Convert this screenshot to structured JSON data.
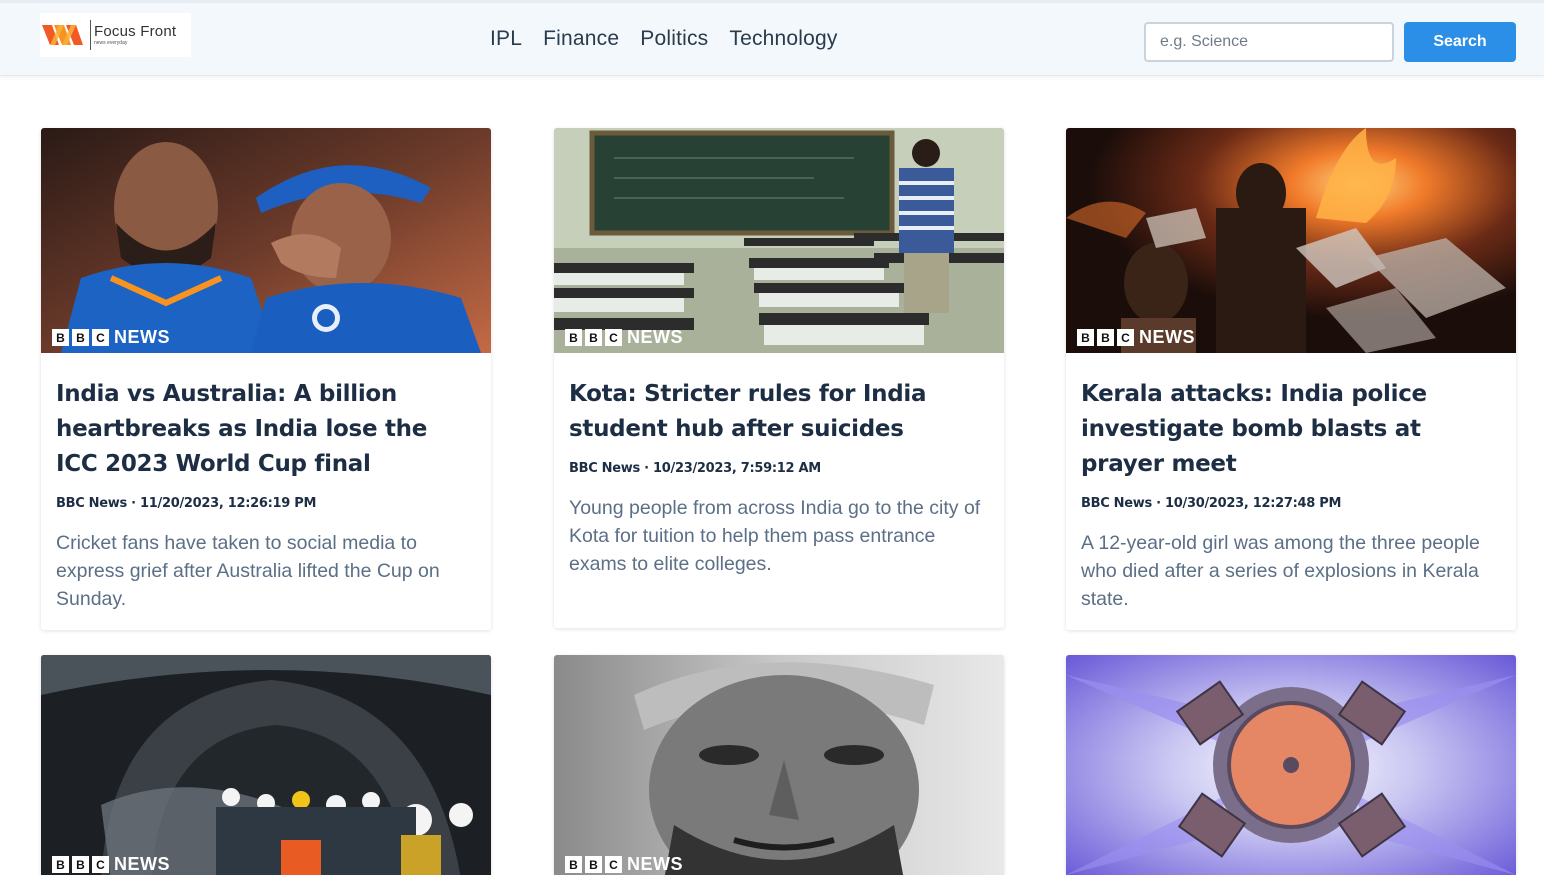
{
  "header": {
    "logo": {
      "title": "Focus Front",
      "tagline": "news everyday"
    },
    "nav": [
      "IPL",
      "Finance",
      "Politics",
      "Technology"
    ],
    "search": {
      "placeholder": "e.g. Science",
      "button_label": "Search"
    }
  },
  "badge": {
    "boxes": [
      "B",
      "B",
      "C"
    ],
    "label": "NEWS"
  },
  "cards": [
    {
      "title": "India vs Australia: A billion heartbreaks as India lose the ICC 2023 World Cup final",
      "meta": "BBC News · 11/20/2023, 12:26:19 PM",
      "desc": "Cricket fans have taken to social media to express grief after Australia lifted the Cup on Sunday."
    },
    {
      "title": "Kota: Stricter rules for India student hub after suicides",
      "meta": "BBC News · 10/23/2023, 7:59:12 AM",
      "desc": "Young people from across India go to the city of Kota for tuition to help them pass entrance exams to elite colleges."
    },
    {
      "title": "Kerala attacks: India police investigate bomb blasts at prayer meet",
      "meta": "BBC News · 10/30/2023, 12:27:48 PM",
      "desc": "A 12-year-old girl was among the three people who died after a series of explosions in Kerala state."
    },
    {
      "title": "",
      "meta": "",
      "desc": ""
    },
    {
      "title": "",
      "meta": "",
      "desc": ""
    },
    {
      "title": "",
      "meta": "",
      "desc": ""
    }
  ]
}
